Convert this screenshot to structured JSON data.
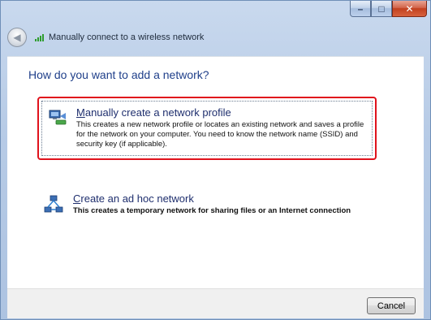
{
  "window": {
    "title": "Manually connect to a wireless network",
    "caption_buttons": {
      "minimize": "–",
      "maximize": "□",
      "close": "✕"
    }
  },
  "page": {
    "heading": "How do you want to add a network?"
  },
  "options": [
    {
      "accesskey": "M",
      "title_rest": "anually create a network profile",
      "description": "This creates a new network profile or locates an existing network and saves a profile for the network on your computer. You need to know the network name (SSID) and security key (if applicable).",
      "icon": "network-profile-icon",
      "highlighted": true
    },
    {
      "accesskey": "C",
      "title_rest": "reate an ad hoc network",
      "description": "This creates a temporary network for sharing files or an Internet connection",
      "icon": "ad-hoc-network-icon",
      "highlighted": false
    }
  ],
  "footer": {
    "cancel_label": "Cancel"
  },
  "colors": {
    "highlight_border": "#e0121c",
    "heading": "#1f3f8a",
    "link_title": "#1f2f6e"
  }
}
